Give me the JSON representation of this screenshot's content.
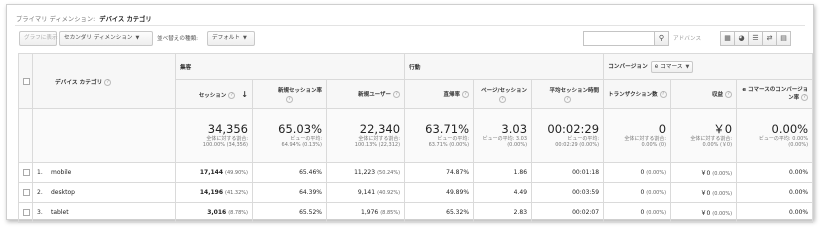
{
  "primary_dimension": {
    "label": "プライマリ ディメンション:",
    "value": "デバイス カテゴリ"
  },
  "toolbar": {
    "plot_rows": "グラフに表示",
    "secondary_dimension": "セカンダリ ディメンション",
    "sort_type_label": "並べ替えの種類:",
    "sort_type_value": "デフォルト",
    "search_placeholder": "",
    "advanced": "アドバンス",
    "view_icons": [
      "grid-view-icon",
      "pie-view-icon",
      "performance-view-icon",
      "comparison-view-icon",
      "pivot-view-icon"
    ]
  },
  "groups": {
    "acquisition": "集客",
    "behavior": "行動",
    "conversion": "コンバージョン",
    "conversion_select": "e コマース"
  },
  "columns": {
    "dimension": "デバイス カテゴリ",
    "sessions": "セッション",
    "new_session_rate": "新規セッション率",
    "new_users": "新規ユーザー",
    "bounce_rate": "直帰率",
    "pages_per_session": "ページ/セッション",
    "avg_session_duration": "平均セッション時間",
    "transactions": "トランザクション数",
    "revenue": "収益",
    "ecommerce_conversion_rate": "e コマースのコンバージョン率"
  },
  "totals": {
    "sessions": {
      "value": "34,356",
      "note1": "全体に対する割合:",
      "note2": "100.00% (34,356)"
    },
    "new_session_rate": {
      "value": "65.03%",
      "note1": "ビューの平均:",
      "note2": "64.94% (0.13%)"
    },
    "new_users": {
      "value": "22,340",
      "note1": "全体に対する割合:",
      "note2": "100.13% (22,312)"
    },
    "bounce_rate": {
      "value": "63.71%",
      "note1": "ビューの平均:",
      "note2": "63.71% (0.00%)"
    },
    "pages_per_session": {
      "value": "3.03",
      "note1": "ビューの平均: 3.03",
      "note2": "(0.00%)"
    },
    "avg_session_duration": {
      "value": "00:02:29",
      "note1": "ビューの平均:",
      "note2": "00:02:29 (0.00%)"
    },
    "transactions": {
      "value": "0",
      "note1": "全体に対する割合:",
      "note2": "0.00% (0)"
    },
    "revenue": {
      "value": "￥0",
      "note1": "全体に対する割合:",
      "note2": "0.00% (￥0)"
    },
    "ecommerce_conversion_rate": {
      "value": "0.00%",
      "note1": "ビューの平均: 0.00%",
      "note2": "(0.00%)"
    }
  },
  "rows": [
    {
      "index": "1.",
      "device": "mobile",
      "sessions": "17,144",
      "sessions_pct": "(49.90%)",
      "new_session_rate": "65.46%",
      "new_users": "11,223",
      "new_users_pct": "(50.24%)",
      "bounce_rate": "74.87%",
      "pages_per_session": "1.86",
      "avg_session_duration": "00:01:18",
      "transactions": "0",
      "transactions_pct": "(0.00%)",
      "revenue": "￥0",
      "revenue_pct": "(0.00%)",
      "ecommerce_conversion_rate": "0.00%"
    },
    {
      "index": "2.",
      "device": "desktop",
      "sessions": "14,196",
      "sessions_pct": "(41.32%)",
      "new_session_rate": "64.39%",
      "new_users": "9,141",
      "new_users_pct": "(40.92%)",
      "bounce_rate": "49.89%",
      "pages_per_session": "4.49",
      "avg_session_duration": "00:03:59",
      "transactions": "0",
      "transactions_pct": "(0.00%)",
      "revenue": "￥0",
      "revenue_pct": "(0.00%)",
      "ecommerce_conversion_rate": "0.00%"
    },
    {
      "index": "3.",
      "device": "tablet",
      "sessions": "3,016",
      "sessions_pct": "(8.78%)",
      "new_session_rate": "65.52%",
      "new_users": "1,976",
      "new_users_pct": "(8.85%)",
      "bounce_rate": "65.32%",
      "pages_per_session": "2.83",
      "avg_session_duration": "00:02:07",
      "transactions": "0",
      "transactions_pct": "(0.00%)",
      "revenue": "￥0",
      "revenue_pct": "(0.00%)",
      "ecommerce_conversion_rate": "0.00%"
    }
  ]
}
